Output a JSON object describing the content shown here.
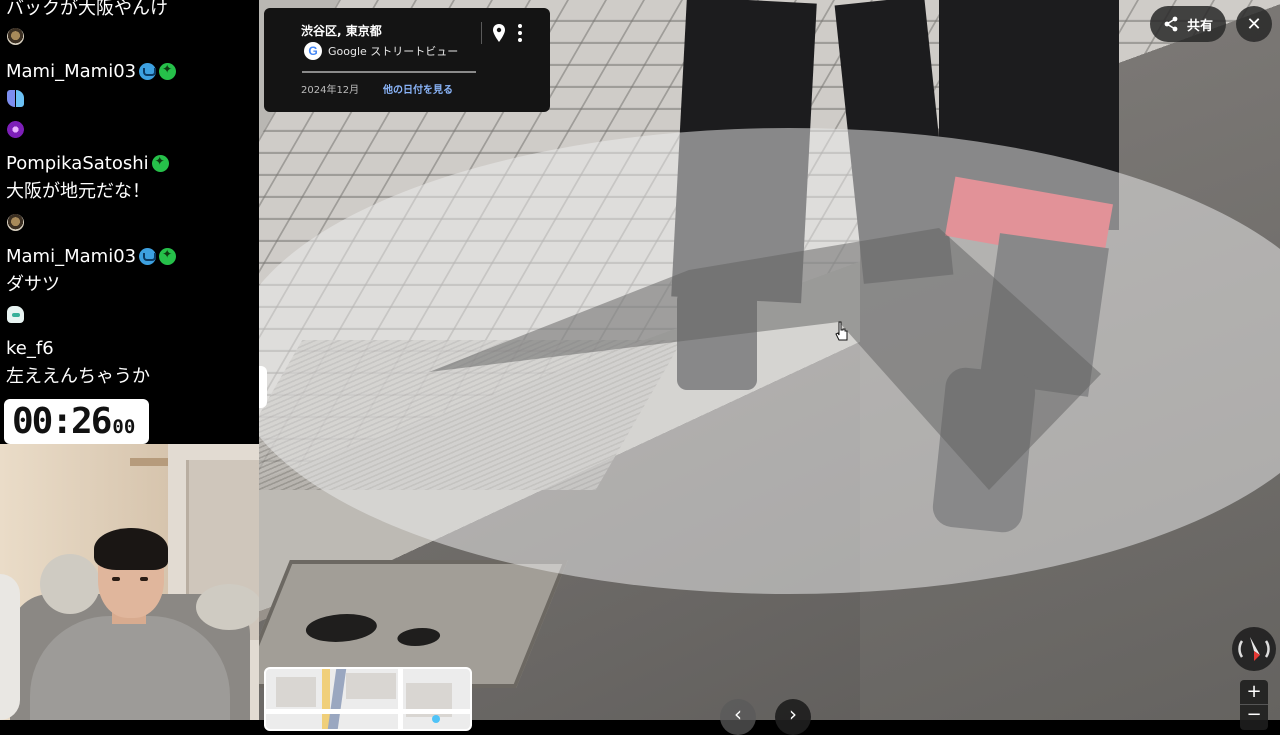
{
  "chat": {
    "partial_top": "バックが大阪やんけ",
    "messages": [
      {
        "user": "Mami_Mami03",
        "text": ""
      },
      {
        "user": "PompikaSatoshi",
        "text": "大阪が地元だな！"
      },
      {
        "user": "Mami_Mami03",
        "text": "ダサツ"
      },
      {
        "user": "ke_f6",
        "text": "左ええんちゃうか"
      }
    ]
  },
  "timer": {
    "main": "00:26",
    "fraction": "00"
  },
  "streetview": {
    "location": "渋谷区, 東京都",
    "source": "Google ストリートビュー",
    "google_letter": "G",
    "date": "2024年12月",
    "other_dates_link": "他の日付を見る",
    "share_label": "共有",
    "close_symbol": "✕",
    "zoom_in_symbol": "+",
    "zoom_out_symbol": "−",
    "nav_prev_symbol": "‹",
    "nav_next_symbol": "›"
  },
  "icons": {
    "share": "share-icon",
    "close": "close-icon",
    "pin": "location-pin-icon",
    "more": "more-vert-icon",
    "compass": "compass-icon"
  },
  "colors": {
    "blue_badge": "#3da0e0",
    "green_badge": "#26c04a",
    "link": "#8ab4f8",
    "card_bg": "#141414"
  }
}
